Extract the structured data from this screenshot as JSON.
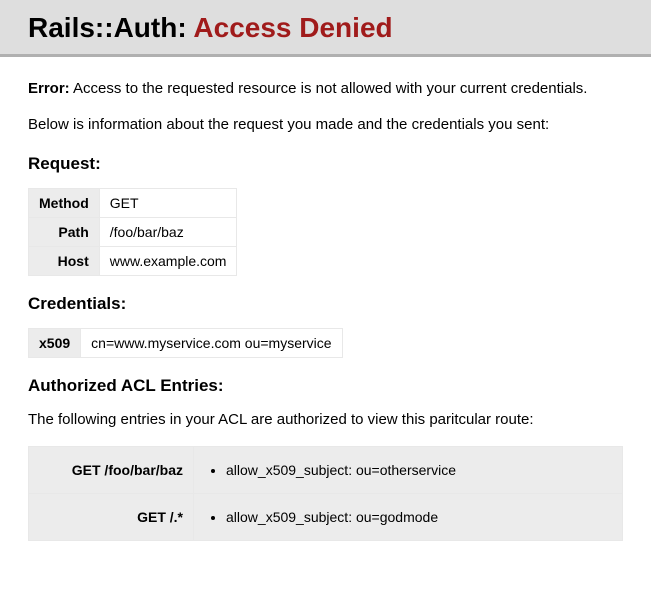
{
  "header": {
    "prefix": "Rails::Auth:",
    "error_title": "Access Denied"
  },
  "error": {
    "label": "Error:",
    "message": "Access to the requested resource is not allowed with your current credentials."
  },
  "intro": "Below is information about the request you made and the credentials you sent:",
  "request": {
    "heading": "Request:",
    "rows": [
      {
        "label": "Method",
        "value": "GET"
      },
      {
        "label": "Path",
        "value": "/foo/bar/baz"
      },
      {
        "label": "Host",
        "value": "www.example.com"
      }
    ]
  },
  "credentials": {
    "heading": "Credentials:",
    "rows": [
      {
        "label": "x509",
        "value": "cn=www.myservice.com ou=myservice"
      }
    ]
  },
  "acl": {
    "heading": "Authorized ACL Entries:",
    "intro": "The following entries in your ACL are authorized to view this paritcular route:",
    "entries": [
      {
        "route": "GET /foo/bar/baz",
        "rules": [
          "allow_x509_subject: ou=otherservice"
        ]
      },
      {
        "route": "GET /.*",
        "rules": [
          "allow_x509_subject: ou=godmode"
        ]
      }
    ]
  }
}
